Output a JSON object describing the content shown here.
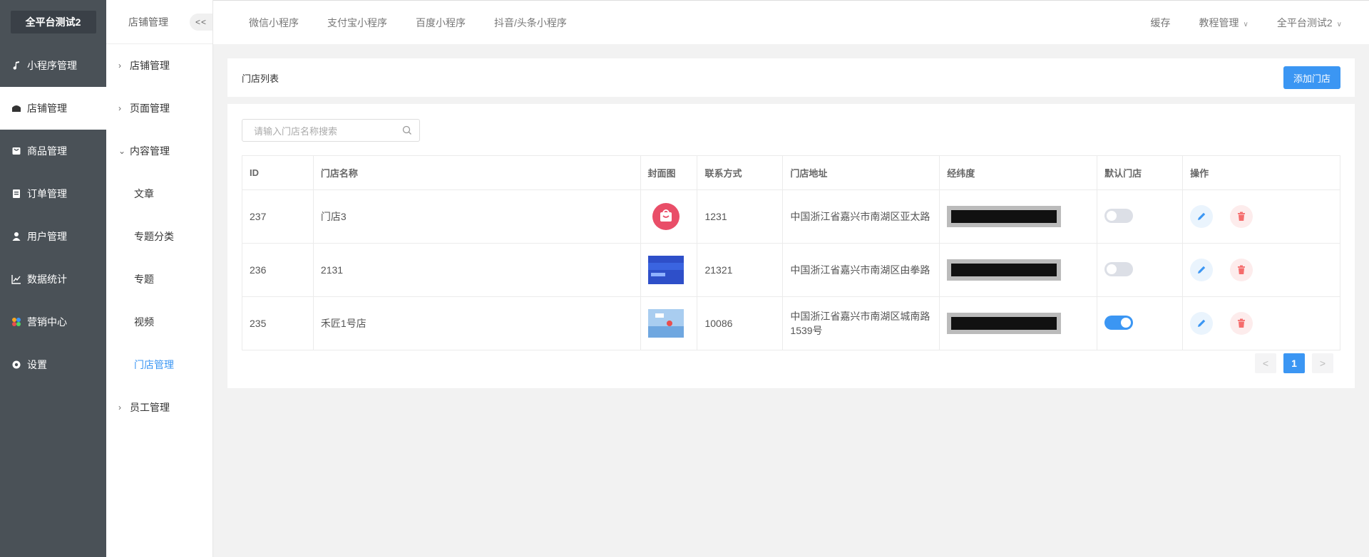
{
  "brand": "全平台测试2",
  "sidebar": {
    "items": [
      {
        "label": "小程序管理",
        "icon": "music-note-icon"
      },
      {
        "label": "店铺管理",
        "icon": "store-icon",
        "active": true
      },
      {
        "label": "商品管理",
        "icon": "bag-icon"
      },
      {
        "label": "订单管理",
        "icon": "clipboard-icon"
      },
      {
        "label": "用户管理",
        "icon": "user-icon"
      },
      {
        "label": "数据统计",
        "icon": "chart-icon"
      },
      {
        "label": "营销中心",
        "icon": "marketing-icon"
      },
      {
        "label": "设置",
        "icon": "gear-icon"
      }
    ]
  },
  "subnav": {
    "title": "店铺管理",
    "collapse": "<<",
    "items": [
      {
        "label": "店铺管理"
      },
      {
        "label": "页面管理"
      },
      {
        "label": "内容管理"
      },
      {
        "label": "文章"
      },
      {
        "label": "专题分类"
      },
      {
        "label": "专题"
      },
      {
        "label": "视频"
      },
      {
        "label": "门店管理"
      },
      {
        "label": "员工管理"
      }
    ]
  },
  "topbar": {
    "tabs": [
      "微信小程序",
      "支付宝小程序",
      "百度小程序",
      "抖音/头条小程序"
    ],
    "cache": "缓存",
    "tutorial": "教程管理",
    "account": "全平台测试2"
  },
  "page": {
    "title": "门店列表",
    "add_button": "添加门店",
    "search_placeholder": "请输入门店名称搜索"
  },
  "table": {
    "headers": [
      "ID",
      "门店名称",
      "封面图",
      "联系方式",
      "门店地址",
      "经纬度",
      "默认门店",
      "操作"
    ],
    "rows": [
      {
        "id": "237",
        "name": "门店3",
        "phone": "1231",
        "address": "中国浙江省嘉兴市南湖区亚太路",
        "default": false
      },
      {
        "id": "236",
        "name": "2131",
        "phone": "21321",
        "address": "中国浙江省嘉兴市南湖区由拳路",
        "default": false
      },
      {
        "id": "235",
        "name": "禾匠1号店",
        "phone": "10086",
        "address": "中国浙江省嘉兴市南湖区城南路1539号",
        "default": true
      }
    ]
  },
  "pagination": {
    "prev": "<",
    "current": "1",
    "next": ">"
  },
  "colors": {
    "accent": "#3b96f3",
    "sidebar": "#4a5157",
    "danger": "#f56c6c"
  }
}
